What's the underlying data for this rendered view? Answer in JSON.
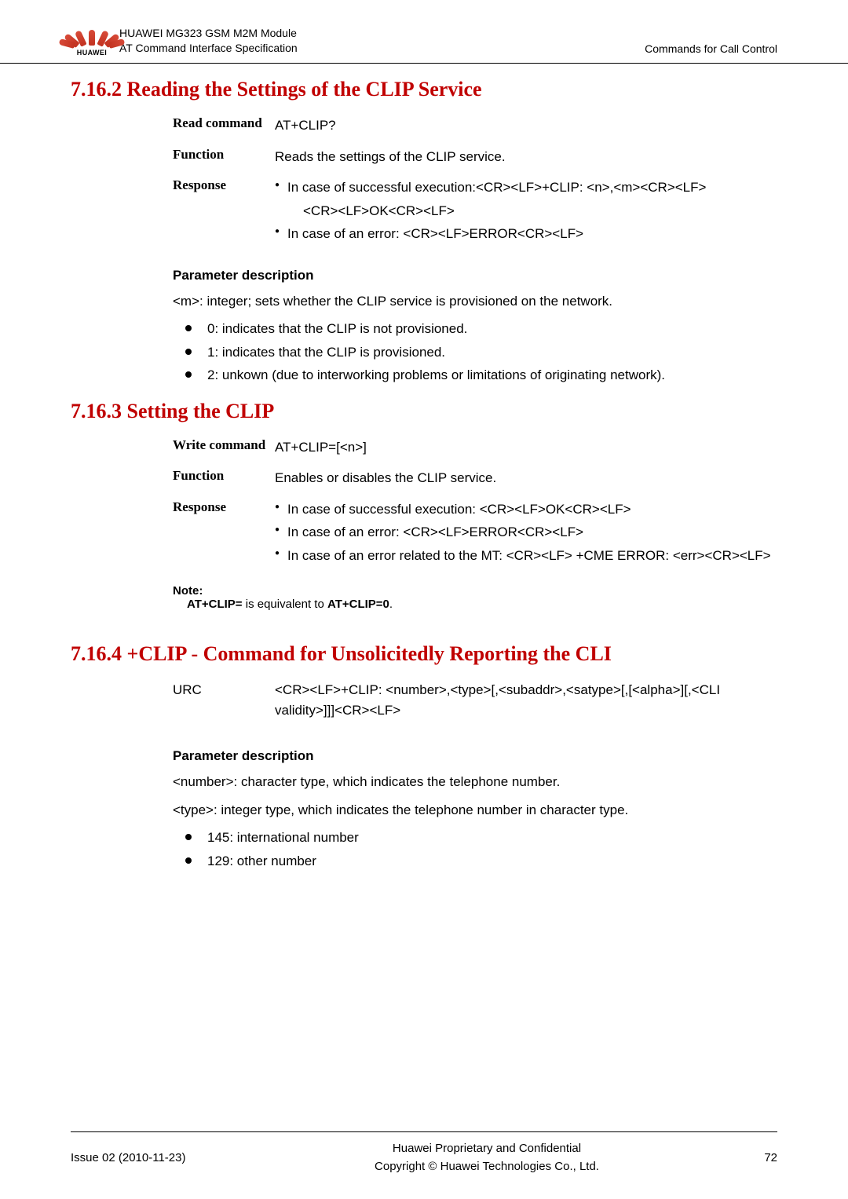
{
  "header": {
    "brand": "HUAWEI",
    "title1": "HUAWEI MG323 GSM M2M Module",
    "title2": "AT Command Interface Specification",
    "right": "Commands for Call Control"
  },
  "s1": {
    "title": "7.16.2 Reading the Settings of the CLIP Service",
    "rows": {
      "read_label": "Read command",
      "read_val": "AT+CLIP?",
      "func_label": "Function",
      "func_val": "Reads the settings of the CLIP service.",
      "resp_label": "Response",
      "resp_b1": "In case of successful execution:<CR><LF>+CLIP: <n>,<m><CR><LF>",
      "resp_b1b": "<CR><LF>OK<CR><LF>",
      "resp_b2": "In case of an error: <CR><LF>ERROR<CR><LF>"
    },
    "param_head": "Parameter description",
    "param_text": "<m>: integer; sets whether the CLIP service is provisioned on the network.",
    "items": {
      "i1": "0: indicates that the CLIP is not provisioned.",
      "i2": "1: indicates that the CLIP is provisioned.",
      "i3": "2: unkown (due to interworking problems or limitations of originating network)."
    }
  },
  "s2": {
    "title": "7.16.3 Setting the CLIP",
    "rows": {
      "write_label": "Write command",
      "write_val": "AT+CLIP=[<n>]",
      "func_label": "Function",
      "func_val": "Enables or disables the CLIP service.",
      "resp_label": "Response",
      "resp_b1": "In case of successful execution: <CR><LF>OK<CR><LF>",
      "resp_b2": "In case of an error: <CR><LF>ERROR<CR><LF>",
      "resp_b3": "In case of an error related to the MT: <CR><LF> +CME ERROR: <err><CR><LF>"
    },
    "note_label": "Note:",
    "note_body_pre": "AT+CLIP=",
    "note_body_mid": " is equivalent to ",
    "note_body_post": "AT+CLIP=0",
    "note_body_end": "."
  },
  "s3": {
    "title": "7.16.4 +CLIP - Command for Unsolicitedly Reporting the CLI",
    "urc_label": "URC",
    "urc_val": "<CR><LF>+CLIP: <number>,<type>[,<subaddr>,<satype>[,[<alpha>][,<CLI validity>]]]<CR><LF>",
    "param_head": "Parameter description",
    "p1": "<number>: character type, which indicates the telephone number.",
    "p2": "<type>: integer type, which indicates the telephone number in character type.",
    "items": {
      "i1": "145: international number",
      "i2": "129: other number"
    }
  },
  "footer": {
    "left": "Issue 02 (2010-11-23)",
    "center1": "Huawei Proprietary and Confidential",
    "center2": "Copyright © Huawei Technologies Co., Ltd.",
    "right": "72"
  }
}
